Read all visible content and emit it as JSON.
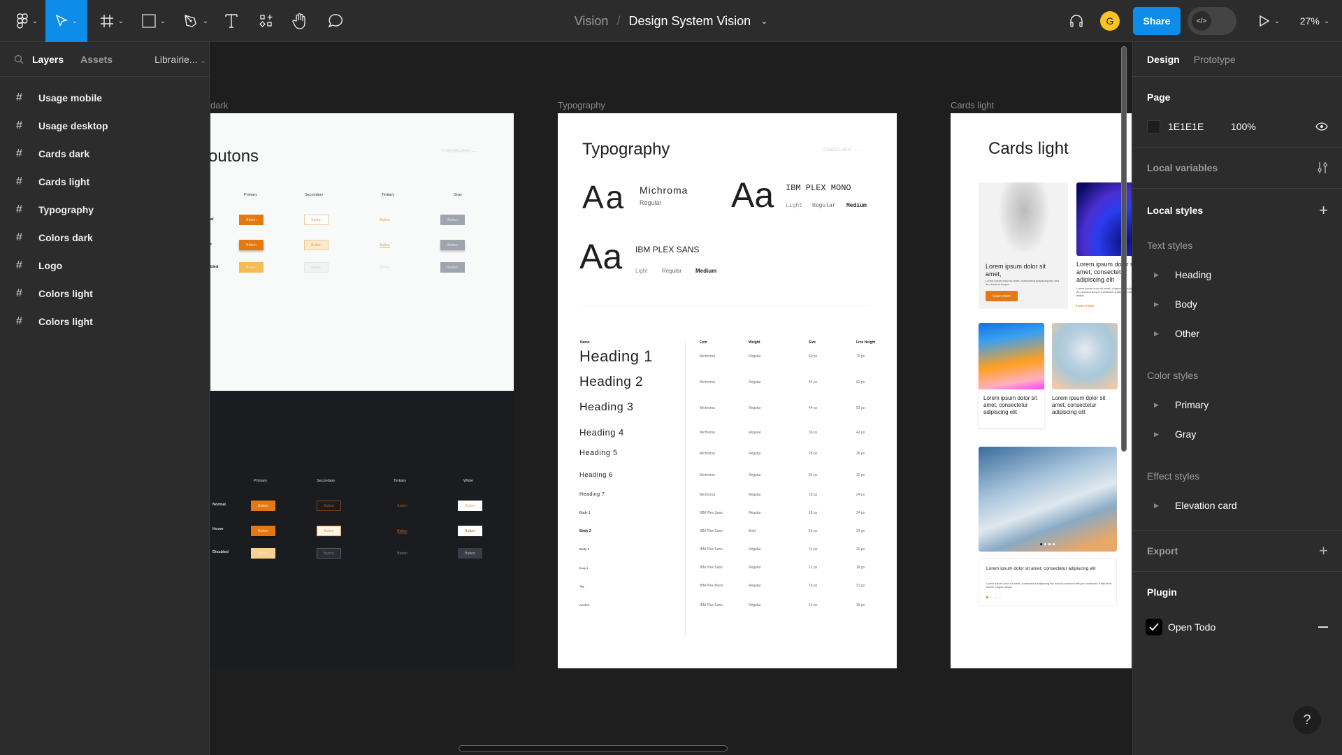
{
  "toolbar": {
    "tools": [
      {
        "name": "figma-menu",
        "icon": "figma-logo-icon"
      },
      {
        "name": "move",
        "icon": "cursor-icon",
        "active": true
      },
      {
        "name": "frame",
        "icon": "frame-icon"
      },
      {
        "name": "shape",
        "icon": "rectangle-icon"
      },
      {
        "name": "pen",
        "icon": "pen-icon"
      },
      {
        "name": "text",
        "icon": "text-icon"
      },
      {
        "name": "resources",
        "icon": "components-icon"
      },
      {
        "name": "hand",
        "icon": "hand-icon"
      },
      {
        "name": "comment",
        "icon": "comment-icon"
      }
    ],
    "project": "Vision",
    "separator": "/",
    "file_name": "Design System Vision",
    "avatar_initial": "G",
    "share_label": "Share",
    "dev_mode_icon": "</>",
    "zoom_level": "27%",
    "accent_color": "#0d8ce9",
    "avatar_color": "#f7c325"
  },
  "left_panel": {
    "tabs": [
      "Layers",
      "Assets"
    ],
    "library_dropdown": "Librairie...",
    "layers": [
      "Usage mobile",
      "Usage desktop",
      "Cards dark",
      "Cards light",
      "Typography",
      "Colors dark",
      "Logo",
      "Colors light",
      "Colors light"
    ]
  },
  "right_panel": {
    "tabs": [
      "Design",
      "Prototype"
    ],
    "page_label": "Page",
    "page_color_hex": "1E1E1E",
    "page_opacity": "100%",
    "local_variables": "Local variables",
    "local_styles": "Local styles",
    "text_styles_label": "Text styles",
    "text_styles": [
      "Heading",
      "Body",
      "Other"
    ],
    "color_styles_label": "Color styles",
    "color_styles": [
      "Primary",
      "Gray"
    ],
    "effect_styles_label": "Effect styles",
    "effect_styles": [
      "Elevation card"
    ],
    "export_label": "Export",
    "plugin_label": "Plugin",
    "plugin_item": "Open Todo",
    "help": "?"
  },
  "canvas": {
    "frames": {
      "buttons": {
        "label": "dark",
        "title": "outons",
        "nav_link": "TYPOGRAPHY",
        "light_columns": [
          "Primary",
          "Secondary",
          "Tertiary",
          "Gray"
        ],
        "light_rows": [
          "al",
          "r",
          "bled"
        ],
        "dark_columns": [
          "Primary",
          "Secondary",
          "Tertiary",
          "White"
        ],
        "dark_rows": [
          "Normal",
          "Hover",
          "Disabled"
        ],
        "button_text": "Button"
      },
      "typography": {
        "label": "Typography",
        "title": "Typography",
        "nav_link": "CARDS LIGHT",
        "specimens": [
          {
            "sample": "Aa",
            "name": "Michroma",
            "weights": [
              "Regular"
            ]
          },
          {
            "sample": "Aa",
            "name": "IBM PLEX MONO",
            "weights": [
              "Light",
              "Regular",
              "Medium"
            ]
          },
          {
            "sample": "Aa",
            "name": "IBM PLEX SANS",
            "weights": [
              "Light",
              "Regular",
              "Medium"
            ]
          }
        ],
        "table_headers": [
          "Name",
          "Font",
          "Weight",
          "Size",
          "Line Height"
        ],
        "rows": [
          [
            "Heading 1",
            "Michroma",
            "Regular",
            "60 px",
            "70 px"
          ],
          [
            "Heading 2",
            "Michroma",
            "Regular",
            "52 px",
            "61 px"
          ],
          [
            "Heading 3",
            "Michroma",
            "Regular",
            "44 px",
            "52 px"
          ],
          [
            "Heading 4",
            "Michroma",
            "Regular",
            "36 px",
            "42 px"
          ],
          [
            "Heading 5",
            "Michroma",
            "Regular",
            "28 px",
            "36 px"
          ],
          [
            "Heading 6",
            "Michroma",
            "Regular",
            "24 px",
            "32 px"
          ],
          [
            "Heading 7",
            "Michroma",
            "Regular",
            "18 px",
            "24 px"
          ],
          [
            "Body 1",
            "IBM Plex Sans",
            "Regular",
            "16 px",
            "24 px"
          ],
          [
            "Body 2",
            "IBM Plex Sans",
            "Bold",
            "15 px",
            "24 px"
          ],
          [
            "Body 3",
            "IBM Plex Sans",
            "Regular",
            "14 px",
            "20 px"
          ],
          [
            "Body 4",
            "IBM Plex Sans",
            "Regular",
            "12 px",
            "18 px"
          ],
          [
            "Tag",
            "IBM Plex Mono",
            "Regular",
            "18 px",
            "21 px"
          ],
          [
            "Anchor",
            "IBM Plex Sans",
            "Regular",
            "14 px",
            "16 px"
          ]
        ]
      },
      "cards_light": {
        "label": "Cards light",
        "title": "Cards light",
        "card1_title": "Lorem ipsum dolor sit amet,",
        "card1_body": "Lorem ipsum dolor sit amet, consectetur adipiscing elit, sed do eiusmod tempor",
        "card1_button": "Learn more",
        "card2_title": "Lorem ipsum dolor sit amet, consectetur adipiscing elit",
        "card2_body": "Lorem ipsum dolor sit amet, consectetur adipiscing elit, sed do eiusmod tempor incididunt ut labore et dolore magna aliqua.",
        "card2_link": "Learn more",
        "card3_title": "Lorem ipsum dolor sit amet, consectetur adipiscing elit",
        "card4_title": "Lorem ipsum dolor sit amet, consectetur adipiscing elit",
        "card5_title": "Lorem ipsum dolor sit amet, consectetur adipiscing elit",
        "card5_body": "Lorem ipsum dolor sit amet, consectetur adipiscing elit, sed do eiusmod tempor incididunt ut labore et dolore magna aliqua."
      }
    },
    "brand_orange": "#e47911"
  }
}
